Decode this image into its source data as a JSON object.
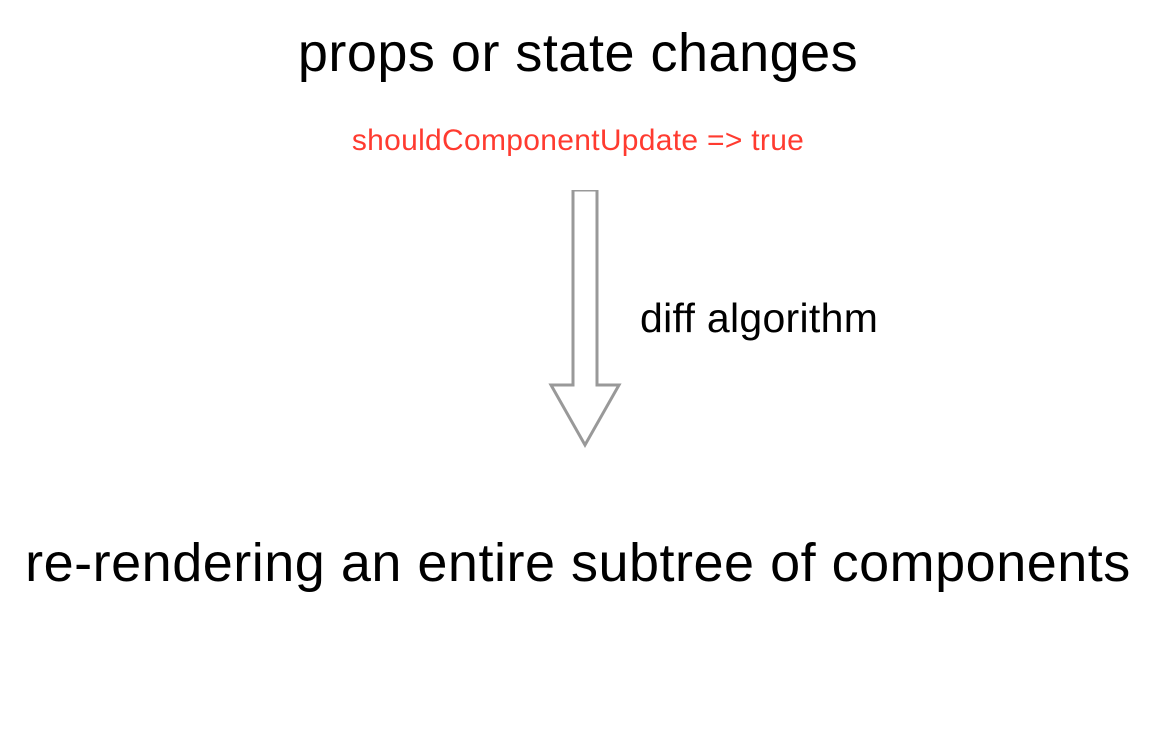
{
  "diagram": {
    "top_node": "props or state changes",
    "condition": "shouldComponentUpdate => true",
    "arrow_label": "diff algorithm",
    "bottom_node": "re-rendering an entire subtree of components"
  },
  "colors": {
    "text": "#000000",
    "accent": "#ff3b30",
    "arrow_stroke": "#999999"
  }
}
